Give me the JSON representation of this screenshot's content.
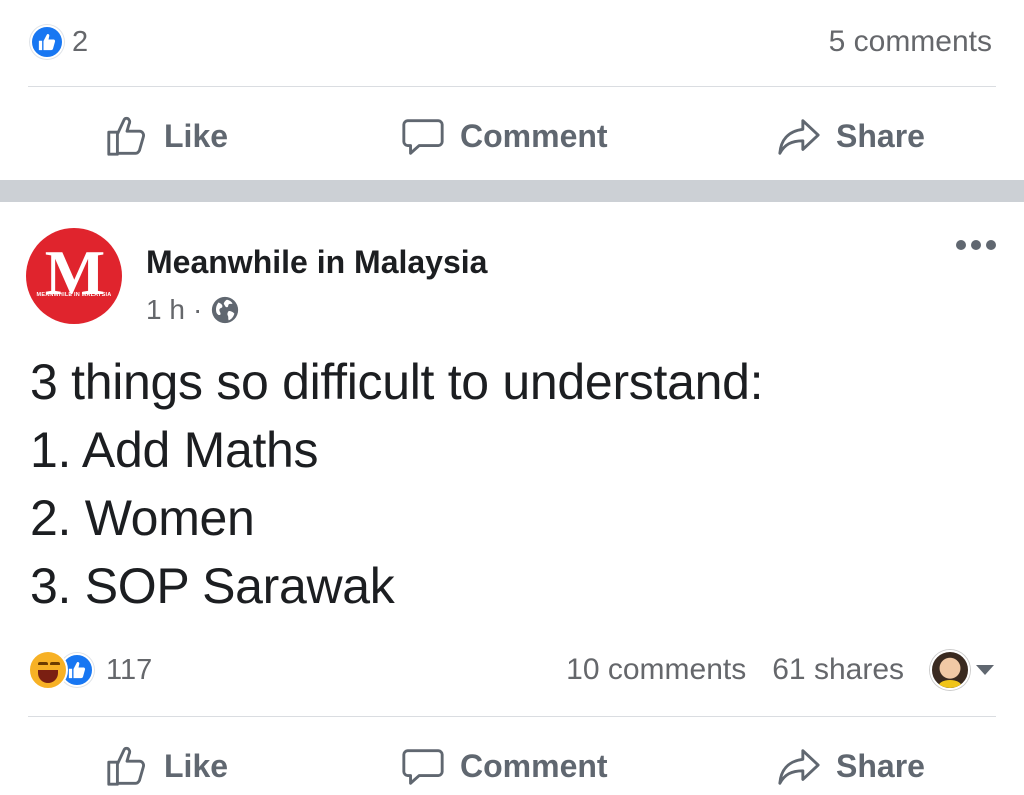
{
  "prev_post": {
    "like_count": "2",
    "comments": "5 comments",
    "actions": {
      "like": "Like",
      "comment": "Comment",
      "share": "Share"
    }
  },
  "post": {
    "page_name": "Meanwhile in Malaysia",
    "avatar_letter": "M",
    "avatar_caption": "MEANWHILE IN MALAYSIA",
    "time": "1 h",
    "time_sep": "·",
    "lines": [
      "3 things so difficult to understand:",
      "1. Add Maths",
      "2. Women",
      "3. SOP Sarawak"
    ],
    "reaction_count": "117",
    "comments": "10 comments",
    "shares": "61 shares",
    "actions": {
      "like": "Like",
      "comment": "Comment",
      "share": "Share"
    }
  },
  "colors": {
    "facebook_blue": "#1877f2",
    "avatar_red": "#e0242d",
    "separator": "#ccd0d5"
  },
  "icons": [
    "like-icon",
    "comment-icon",
    "share-icon",
    "globe-icon",
    "more-icon",
    "haha-reaction-icon",
    "caret-down-icon"
  ]
}
